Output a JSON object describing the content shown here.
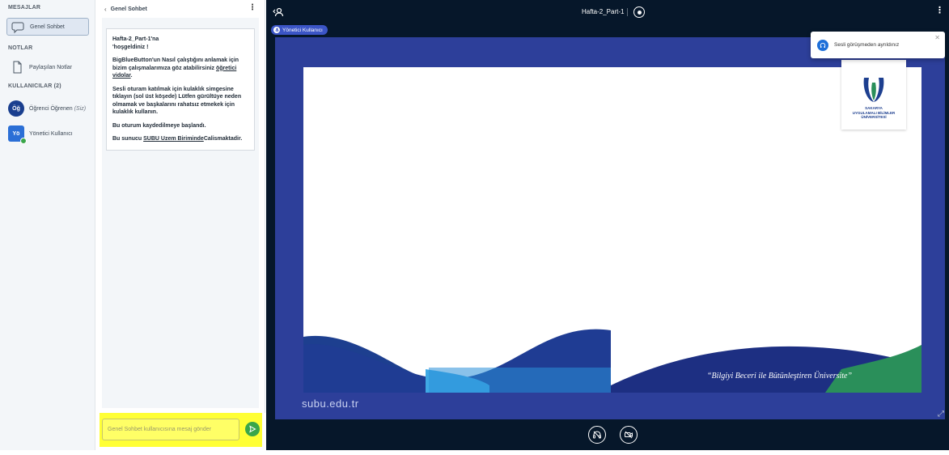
{
  "sidebar": {
    "messages_title": "MESAJLAR",
    "public_chat_label": "Genel Sohbet",
    "notes_title": "NOTLAR",
    "shared_notes_label": "Paylaşılan Notlar",
    "users_title": "KULLANICILAR (2)",
    "users": [
      {
        "initials": "Öğ",
        "name": "Öğrenci Öğrenen",
        "suffix": "(Siz)",
        "color": "#1a3f8f"
      },
      {
        "initials": "Yö",
        "name": "Yönetici Kullanıcı",
        "suffix": "",
        "color": "#2b6fd6"
      }
    ]
  },
  "chat": {
    "back_label": "Genel Sohbet",
    "welcome": {
      "line1": "Hafta-2_Part-1'na",
      "line2": "'hoşgeldiniz !",
      "p2_a": "BigBlueButton'un Nasıl çalıştığını anlamak için bizim çalışmalarımıza göz atabilirsiniz ",
      "p2_link": "öğretici vidolar",
      "p2_end": ".",
      "p3_a": "Sesli oturam katılmak için kulaklık simgesine tıklayın (sol üst köşede) ",
      "p3_b": "Lütfen gürültüye neden olmamak ve başkalarını rahatsız etmekek için kulaklık kullanın.",
      "p4": "Bu oturum kaydedilmeye başlandı.",
      "p5_a": "Bu sunucu ",
      "p5_link": "SUBU Uzem Biriminde",
      "p5_b": "Calismaktadir."
    },
    "input_placeholder": "Genel Sohbet kullanıcısına mesaj gönder"
  },
  "stage": {
    "meeting_title": "Hafta-2_Part-1",
    "talker_name": "Yönetici Kullanıcı",
    "slide_url": "subu.edu.tr",
    "slide_quote": "“Bilgiyi Beceri ile Bütünleştiren Üniversite”",
    "logo_lines": [
      "SAKARYA",
      "UYGULAMALI BİLİMLER",
      "ÜNİVERSİTESİ"
    ],
    "toast_message": "Sesli görüşmeden ayrıldınız"
  },
  "colors": {
    "accent_blue": "#1e6fd9",
    "stage_bg": "#06172a",
    "slide_blue": "#2d3f9a",
    "highlight_yellow": "#ffff35",
    "send_green": "#3aa64a"
  }
}
